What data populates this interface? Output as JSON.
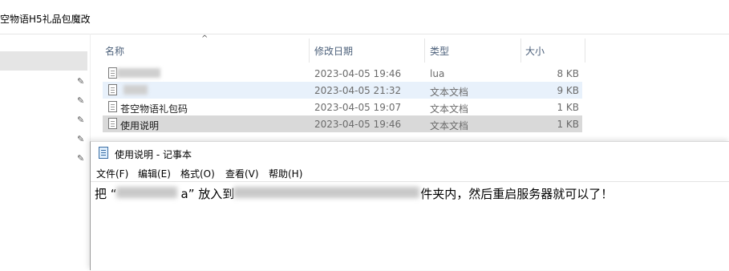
{
  "explorer": {
    "title": "空物语H5礼品包魔改",
    "columns": {
      "name": "名称",
      "date": "修改日期",
      "type": "类型",
      "size": "大小"
    },
    "files": [
      {
        "name": "",
        "date": "2023-04-05 19:46",
        "type": "lua",
        "size": "8 KB"
      },
      {
        "name": "",
        "date": "2023-04-05 21:32",
        "type": "文本文档",
        "size": "9 KB"
      },
      {
        "name": "苍空物语礼包码",
        "date": "2023-04-05 19:07",
        "type": "文本文档",
        "size": "1 KB"
      },
      {
        "name": "使用说明",
        "date": "2023-04-05 19:46",
        "type": "文本文档",
        "size": "1 KB"
      }
    ],
    "nav_pin_icon": "pin-icon",
    "sort_icon": "sort-up-icon"
  },
  "notepad": {
    "title": "使用说明 - 记事本",
    "menu": [
      "文件(F)",
      "编辑(E)",
      "格式(O)",
      "查看(V)",
      "帮助(H)"
    ],
    "content": {
      "part1": "把 “",
      "part2": "a” 放入到",
      "part3": "件夹内，然后重启服务器就可以了！"
    }
  }
}
